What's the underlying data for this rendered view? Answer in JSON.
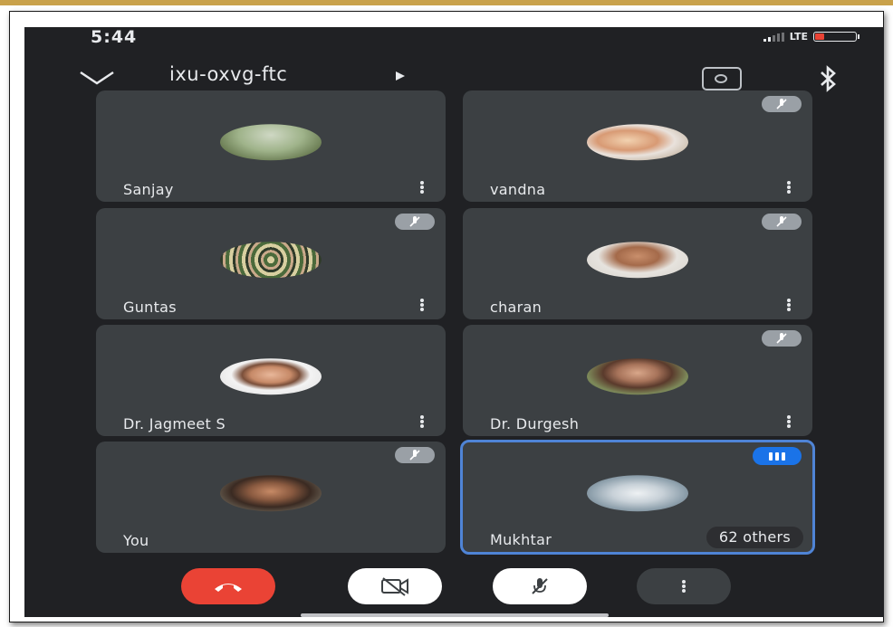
{
  "status_bar": {
    "time": "5:44",
    "network": "LTE"
  },
  "header": {
    "meeting_code": "ixu-oxvg-ftc",
    "icons": [
      "chevron-down-icon",
      "play-arrow-icon",
      "camera-switch-icon",
      "bluetooth-icon"
    ]
  },
  "participants": [
    {
      "name": "Sanjay",
      "muted": false,
      "speaking": false
    },
    {
      "name": "vandna",
      "muted": true,
      "speaking": false
    },
    {
      "name": "Guntas",
      "muted": true,
      "speaking": false
    },
    {
      "name": "charan",
      "muted": true,
      "speaking": false
    },
    {
      "name": "Dr. Jagmeet S",
      "muted": false,
      "speaking": false
    },
    {
      "name": "Dr. Durgesh",
      "muted": true,
      "speaking": false
    },
    {
      "name": "You",
      "muted": true,
      "speaking": false
    },
    {
      "name": "Mukhtar",
      "muted": false,
      "speaking": true
    }
  ],
  "others_label": "62 others",
  "controls": {
    "icons": [
      "end-call-icon",
      "camera-off-icon",
      "mic-off-icon",
      "more-vert-icon"
    ]
  },
  "colors": {
    "background": "#202124",
    "tile": "#3c4043",
    "end_call": "#ea4335",
    "speaking_accent": "#1a73e8",
    "active_border": "#4f84d6"
  }
}
